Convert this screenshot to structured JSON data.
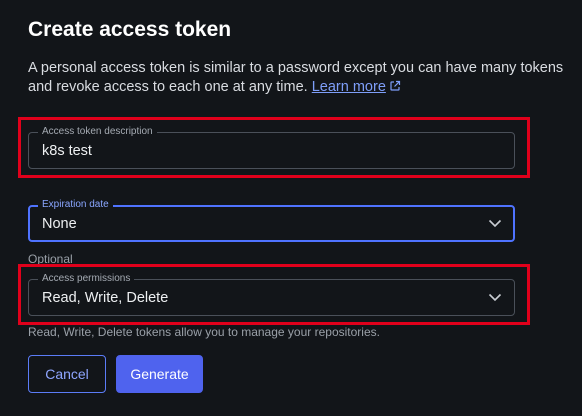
{
  "dialog": {
    "title": "Create access token",
    "description": "A personal access token is similar to a password except you can have many tokens and revoke access to each one at any time.",
    "learn_more_label": "Learn more",
    "external_link_icon": "external-link-icon"
  },
  "fields": {
    "description": {
      "label": "Access token description",
      "value": "k8s test"
    },
    "expiration": {
      "label": "Expiration date",
      "value": "None",
      "helper": "Optional"
    },
    "permissions": {
      "label": "Access permissions",
      "value": "Read, Write, Delete",
      "helper": "Read, Write, Delete tokens allow you to manage your repositories."
    }
  },
  "buttons": {
    "cancel_label": "Cancel",
    "generate_label": "Generate"
  },
  "colors": {
    "background": "#121519",
    "accent": "#4f63ee",
    "focus_border": "#4f73ff",
    "annotation_red": "#e0001b",
    "link": "#7e9ef9"
  }
}
